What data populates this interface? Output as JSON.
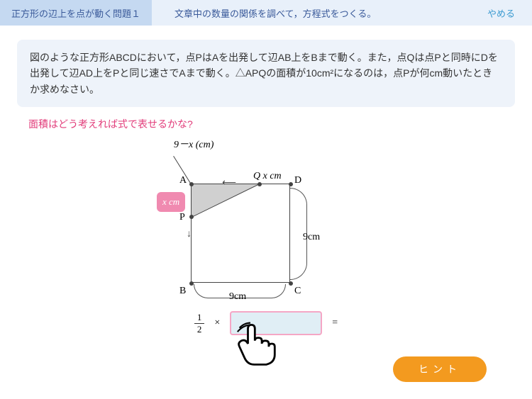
{
  "header": {
    "left": "正方形の辺上を点が動く問題１",
    "center": "文章中の数量の関係を調べて，方程式をつくる。",
    "right": "やめる"
  },
  "problem_text": "図のような正方形ABCDにおいて，点PはAを出発して辺AB上をBまで動く。また，点Qは点Pと同時にDを出発して辺AD上をPと同じ速さでAまで動く。△APQの面積が10cm²になるのは，点Pが何cm動いたときか求めなさい。",
  "hint_question": "面積はどう考えれば式で表せるかな?",
  "diagram": {
    "expr_top": "9－x (cm)",
    "A": "A",
    "B": "B",
    "C": "C",
    "D": "D",
    "P": "P",
    "Q": "Q x cm",
    "xcm_badge": "x cm",
    "side_b": "9cm",
    "side_r": "9cm"
  },
  "equation": {
    "fraction_num": "1",
    "fraction_den": "2",
    "times": "×",
    "equals": "="
  },
  "hint_button": "ヒント"
}
